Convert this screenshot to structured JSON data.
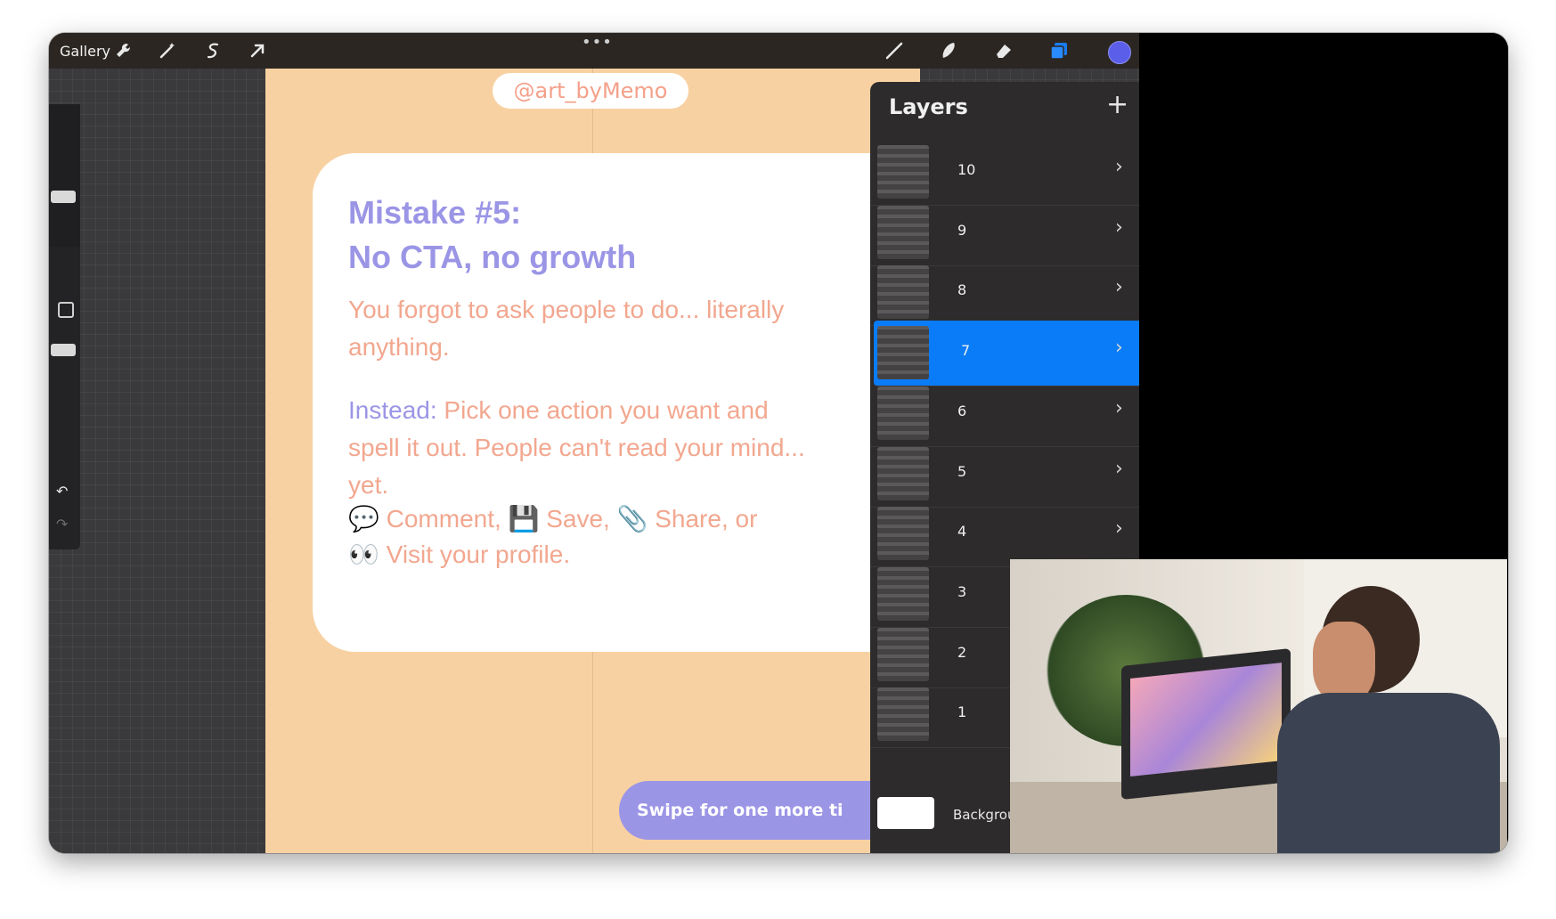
{
  "toolbar": {
    "gallery_label": "Gallery",
    "more_label": "•••",
    "tools": [
      "wrench-icon",
      "magic-wand-icon",
      "selection-icon",
      "transform-arrow-icon"
    ],
    "drawing_tools": [
      "brush-icon",
      "smudge-icon",
      "eraser-icon",
      "layers-icon"
    ],
    "active_color": "#5b5ee8"
  },
  "canvas": {
    "handle": "@art_byMemo",
    "title_line1": "Mistake #5:",
    "title_line2": "No CTA, no growth",
    "para1": "You forgot to ask people to do... literally anything.",
    "instead_label": "Instead:",
    "instead_text": " Pick one action you want and spell it out. People can't read your mind... yet.",
    "cta_line1": "💬 Comment, 💾 Save, 📎 Share, or",
    "cta_line2": "👀 Visit your profile.",
    "swipe": "Swipe for one more ti",
    "colors": {
      "background": "#f8d1a2",
      "title": "#9b95e6",
      "body": "#f2a78f"
    }
  },
  "layers": {
    "title": "Layers",
    "add_label": "+",
    "items": [
      {
        "number": "10",
        "checked": false,
        "active": false
      },
      {
        "number": "9",
        "checked": false,
        "active": false
      },
      {
        "number": "8",
        "checked": false,
        "active": false
      },
      {
        "number": "7",
        "checked": false,
        "active": true
      },
      {
        "number": "6",
        "checked": true,
        "active": false
      },
      {
        "number": "5",
        "checked": false,
        "active": false
      },
      {
        "number": "4",
        "checked": false,
        "active": false
      },
      {
        "number": "3",
        "checked": false,
        "active": false
      },
      {
        "number": "2",
        "checked": false,
        "active": false
      },
      {
        "number": "1",
        "checked": false,
        "active": false
      }
    ],
    "background_label": "Background colou"
  }
}
